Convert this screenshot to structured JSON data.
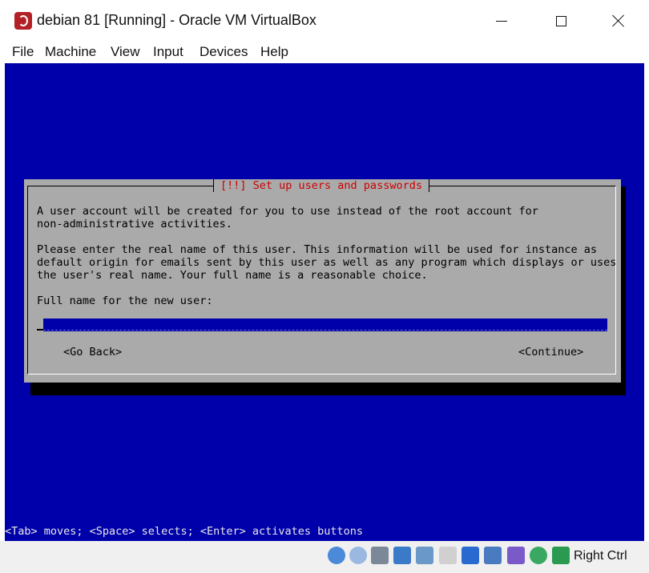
{
  "window": {
    "title": "debian 81 [Running] - Oracle VM VirtualBox",
    "icon": "virtualbox-icon"
  },
  "menu": [
    "File",
    "Machine",
    "View",
    "Input",
    "Devices",
    "Help"
  ],
  "installer": {
    "dialog_title": "[!!] Set up users and passwords",
    "para1": "A user account will be created for you to use instead of the root account for\nnon-administrative activities.",
    "para2": "Please enter the real name of this user. This information will be used for instance as\ndefault origin for emails sent by this user as well as any program which displays or uses\nthe user's real name. Your full name is a reasonable choice.",
    "field_label": "Full name for the new user:",
    "field_value": "",
    "go_back": "<Go Back>",
    "continue": "<Continue>",
    "hint": "<Tab> moves; <Space> selects; <Enter> activates buttons"
  },
  "statusbar": {
    "icons": [
      "hard-disk-icon",
      "optical-drive-icon",
      "audio-icon",
      "network-icon",
      "usb-icon",
      "shared-folders-icon",
      "display-icon",
      "capture-icon",
      "vt-x-icon",
      "mouse-integration-icon",
      "keyboard-icon"
    ],
    "host_key": "Right Ctrl"
  },
  "colors": {
    "vm_background": "#0000aa",
    "dialog_background": "#aaaaaa",
    "dialog_title": "#cc0000"
  }
}
